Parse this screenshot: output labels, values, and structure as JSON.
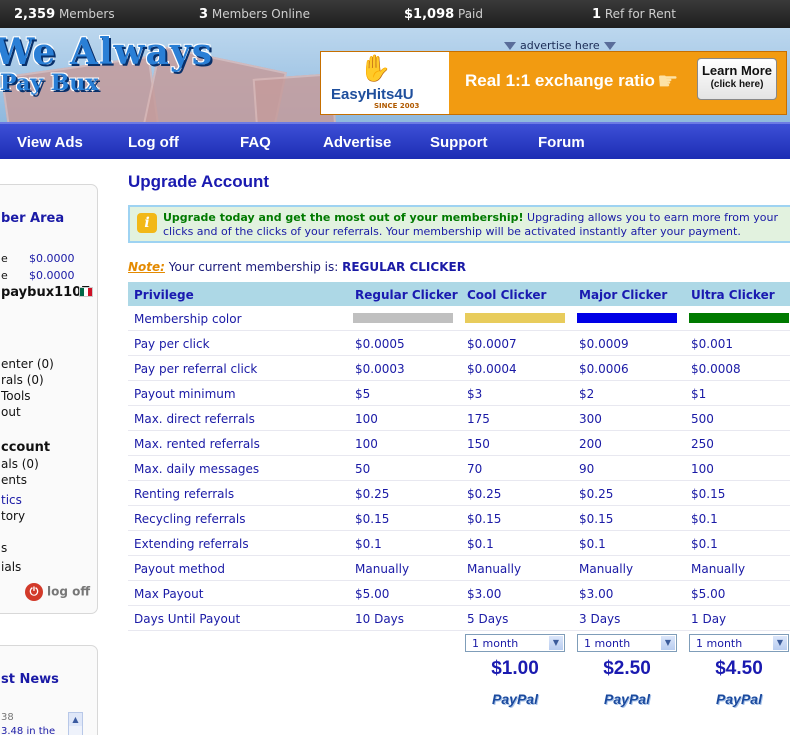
{
  "stats": {
    "members_value": "2,359",
    "members_label": "Members",
    "online_value": "3",
    "online_label": "Members Online",
    "paid_value": "$1,098",
    "paid_label": "Paid",
    "rent_value": "1",
    "rent_label": "Ref for Rent"
  },
  "banner": {
    "logo_line1": "We Always",
    "logo_line2": "Pay Bux",
    "advertise_here": "advertise here",
    "ad_brand": "EasyHits4U",
    "ad_since": "SINCE 2003",
    "ad_text": "Real 1:1 exchange ratio",
    "ad_button_line1": "Learn More",
    "ad_button_line2": "(click here)"
  },
  "nav": [
    "View Ads",
    "Log off",
    "FAQ",
    "Advertise",
    "Support",
    "Forum"
  ],
  "sidebar": {
    "heading": "ber Area",
    "balance1_label": "e",
    "balance1_value": "$0.0000",
    "balance2_label": "e",
    "balance2_value": "$0.0000",
    "username": "paybux1107",
    "items1": [
      "enter (0)",
      "rals (0)",
      "Tools",
      "out"
    ],
    "account_heading": "ccount",
    "items2": [
      "als (0)",
      "ents"
    ],
    "items3": [
      "tics",
      "tory"
    ],
    "items4": [
      "s",
      "ials"
    ],
    "logoff": "log off"
  },
  "news": {
    "heading": "st News",
    "line1": "38",
    "line2": "3.48 in the"
  },
  "main": {
    "title": "Upgrade Account",
    "notice_bold": "Upgrade today and get the most out of your membership!",
    "notice_text": " Upgrading allows you to earn more from your clicks and of the clicks of your referrals. Your membership will be activated instantly after your payment.",
    "note_label": "Note:",
    "note_text": " Your current membership is: ",
    "current_membership": "REGULAR CLICKER"
  },
  "table": {
    "headers": [
      "Privilege",
      "Regular Clicker",
      "Cool Clicker",
      "Major Clicker",
      "Ultra Clicker"
    ],
    "membership_colors": [
      "#c0c0c0",
      "#e8cc5c",
      "#0000e6",
      "#007a00"
    ],
    "rows": [
      [
        "Membership color",
        "",
        "",
        "",
        ""
      ],
      [
        "Pay per click",
        "$0.0005",
        "$0.0007",
        "$0.0009",
        "$0.001"
      ],
      [
        "Pay per referral click",
        "$0.0003",
        "$0.0004",
        "$0.0006",
        "$0.0008"
      ],
      [
        "Payout minimum",
        "$5",
        "$3",
        "$2",
        "$1"
      ],
      [
        "Max. direct referrals",
        "100",
        "175",
        "300",
        "500"
      ],
      [
        "Max. rented referrals",
        "100",
        "150",
        "200",
        "250"
      ],
      [
        "Max. daily messages",
        "50",
        "70",
        "90",
        "100"
      ],
      [
        "Renting referrals",
        "$0.25",
        "$0.25",
        "$0.25",
        "$0.15"
      ],
      [
        "Recycling referrals",
        "$0.15",
        "$0.15",
        "$0.15",
        "$0.1"
      ],
      [
        "Extending referrals",
        "$0.1",
        "$0.1",
        "$0.1",
        "$0.1"
      ],
      [
        "Payout method",
        "Manually",
        "Manually",
        "Manually",
        "Manually"
      ],
      [
        "Max Payout",
        "$5.00",
        "$3.00",
        "$3.00",
        "$5.00"
      ],
      [
        "Days Until Payout",
        "10 Days",
        "5 Days",
        "3 Days",
        "1 Day"
      ]
    ],
    "plans": [
      {
        "duration": "1 month",
        "price": "$1.00",
        "pay": "PayPal"
      },
      {
        "duration": "1 month",
        "price": "$2.50",
        "pay": "PayPal"
      },
      {
        "duration": "1 month",
        "price": "$4.50",
        "pay": "PayPal"
      }
    ]
  },
  "icons": {
    "info": "info-icon",
    "power": "power-icon",
    "dropdown": "chevron-down-icon",
    "pointing_hand": "pointing-hand-icon"
  }
}
